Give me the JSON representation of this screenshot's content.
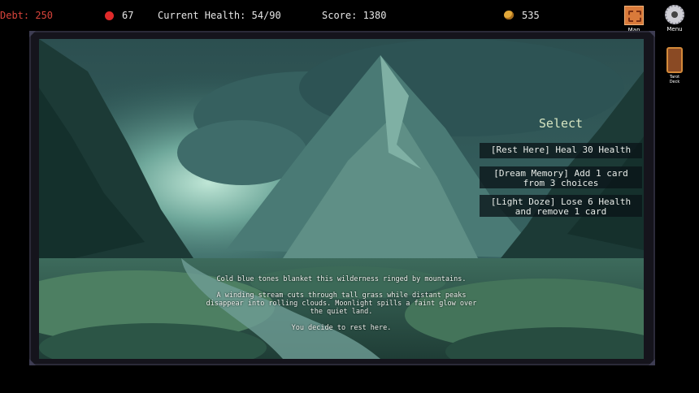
{
  "hud": {
    "debt": "Debt: 250",
    "hp_value": "67",
    "current_health": "Current Health: 54/90",
    "score": "Score: 1380",
    "gold": "535",
    "map_label": "Map",
    "menu_label": "Menu",
    "deck_label": "Tarot Deck"
  },
  "colors": {
    "debt": "#d9443b",
    "hp": "#e02a2a",
    "gold": "#e3a93a",
    "select_title": "#d7e6c2"
  },
  "select": {
    "title": "Select",
    "choices": [
      {
        "label": "[Rest Here] Heal 30 Health"
      },
      {
        "label": "[Dream Memory] Add 1 card from 3 choices"
      },
      {
        "label": "[Light Doze] Lose 6 Health and remove 1 card"
      }
    ]
  },
  "narrative": {
    "line1": "Cold blue tones blanket this wilderness ringed by mountains.",
    "line2": "A winding stream cuts through tall grass while distant peaks disappear into rolling clouds. Moonlight spills a faint glow over the quiet land.",
    "line3": "You decide to rest here."
  },
  "icons": [
    "heart-icon",
    "coin-icon",
    "map-icon",
    "gear-icon",
    "deck-icon"
  ]
}
